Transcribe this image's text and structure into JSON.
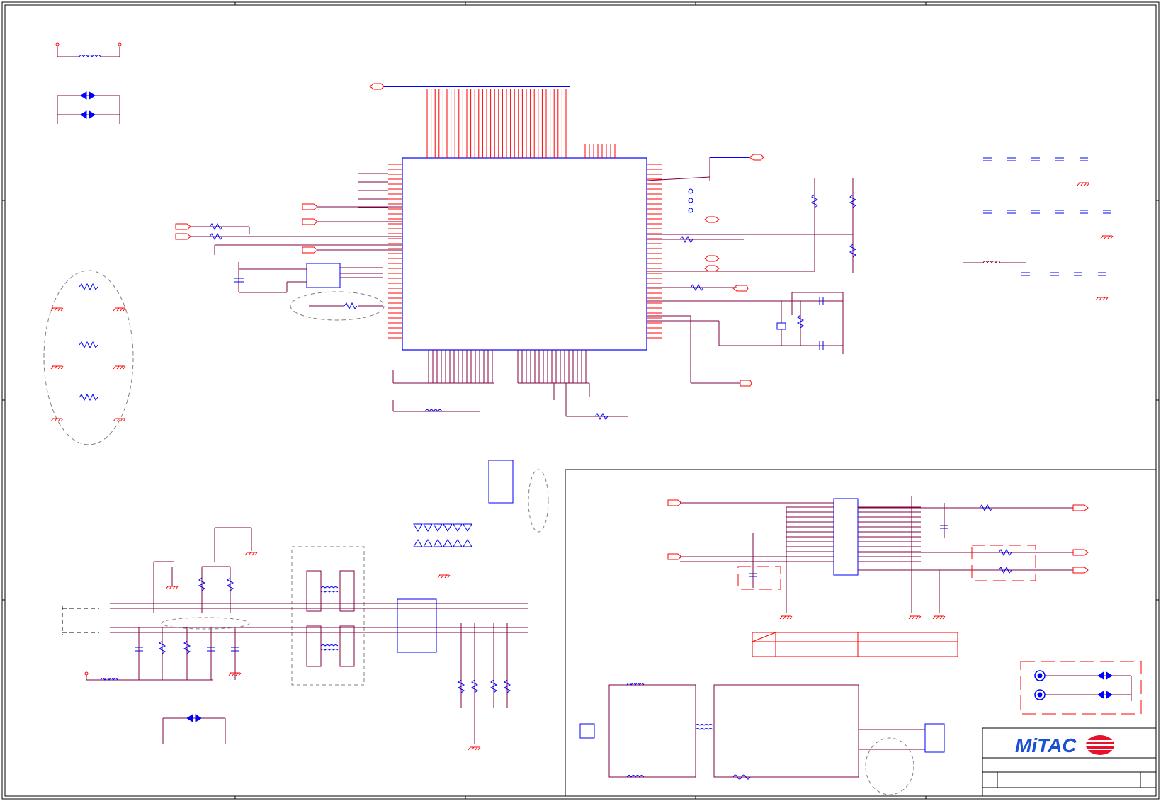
{
  "document": {
    "type": "electrical schematic sheet",
    "colors": {
      "border": "#000000",
      "wire": "#800040",
      "pin": "#ff0000",
      "component": "#0000ff",
      "ground": "#ff0000",
      "annotation": "#808080",
      "logo_blue": "#1a4fd6",
      "logo_red": "#e8102a"
    }
  },
  "title_block": {
    "company_logo_text": "MiTAC"
  }
}
